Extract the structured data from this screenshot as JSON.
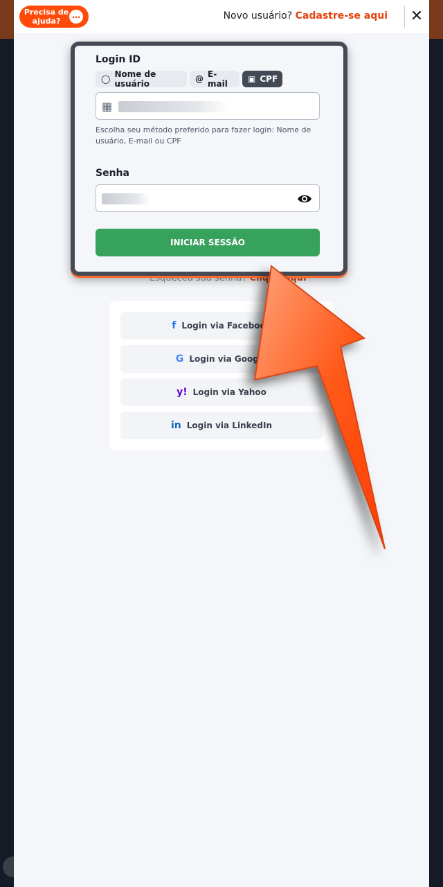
{
  "header": {
    "help_label": "Precisa de ajuda?",
    "new_user_text": "Novo usuário?",
    "signup_link": "Cadastre-se aqui",
    "close_icon": "close-icon"
  },
  "login": {
    "login_id_label": "Login ID",
    "tabs": [
      {
        "label": "Nome de usuário",
        "icon": "user-icon"
      },
      {
        "label": "E-mail",
        "icon": "at-icon"
      },
      {
        "label": "CPF",
        "icon": "id-badge-icon",
        "active": true
      }
    ],
    "hint": "Escolha seu método preferido para fazer login: Nome de usuário, E-mail ou CPF",
    "password_label": "Senha",
    "submit_label": "INICIAR SESSÃO"
  },
  "forgot": {
    "text": "Esqueceu sua senha?",
    "link": "Clique aqui"
  },
  "social": [
    {
      "label": "Login via Facebook",
      "icon": "facebook-icon",
      "color": "#1877f2"
    },
    {
      "label": "Login via Google",
      "icon": "google-icon",
      "color": "#4285f4"
    },
    {
      "label": "Login via Yahoo",
      "icon": "yahoo-icon",
      "color": "#6001d2"
    },
    {
      "label": "Login via LinkedIn",
      "icon": "linkedin-icon",
      "color": "#0a66c2"
    }
  ],
  "colors": {
    "accent": "#e5420f",
    "submit": "#36a25c",
    "arrow": "#ff5a1a"
  }
}
